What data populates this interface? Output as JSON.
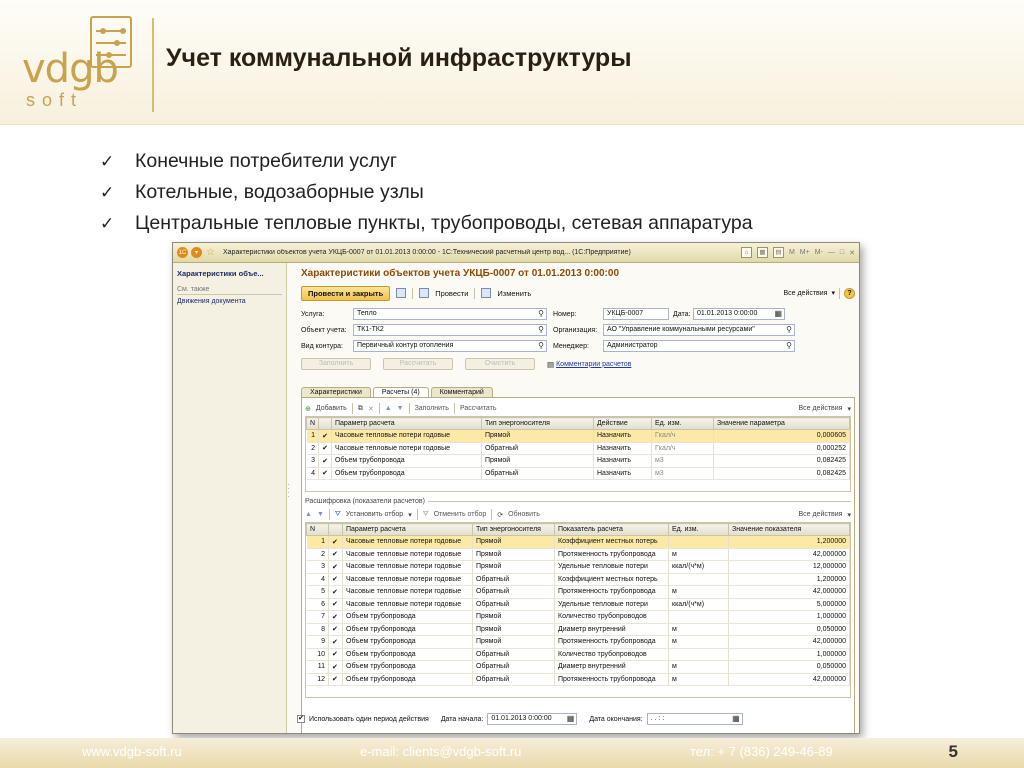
{
  "slide": {
    "logo": {
      "main": "vdgb",
      "sub": "soft"
    },
    "title": "Учет коммунальной инфраструктуры",
    "bullets": [
      "Конечные потребители услуг",
      "Котельные, водозаборные узлы",
      "Центральные тепловые пункты, трубопроводы,  сетевая аппаратура"
    ],
    "footer": {
      "website": "www.vdgb-soft.ru",
      "email": "e-mail: clients@vdgb-soft.ru",
      "phone": "тел: + 7 (836) 249-46-89",
      "page": "5"
    }
  },
  "window": {
    "title": "Характеристики объектов учета УКЦБ-0007 от 01.01.2013 0:00:00 - 1С:Технический расчетный центр вод... (1С:Предприятие)",
    "toolbar_labels": [
      "M",
      "M+",
      "M-"
    ],
    "side": {
      "title": "Характеристики объе...",
      "group": "См. также",
      "link": "Движения документа"
    },
    "form_title": "Характеристики объектов учета УКЦБ-0007 от 01.01.2013 0:00:00",
    "commands": {
      "post_close": "Провести и закрыть",
      "post": "Провести",
      "edit": "Изменить",
      "all_actions": "Все действия",
      "help": "?"
    },
    "fields": {
      "service_label": "Услуга:",
      "service_value": "Тепло",
      "object_label": "Объект учета:",
      "object_value": "ТК1-ТК2",
      "circuit_label": "Вид контура:",
      "circuit_value": "Первичный контур отопления",
      "number_label": "Номер:",
      "number_value": "УКЦБ-0007",
      "date_label": "Дата:",
      "date_value": "01.01.2013  0:00:00",
      "org_label": "Организация:",
      "org_value": "АО \"Управление коммунальными ресурсами\"",
      "manager_label": "Менеджер:",
      "manager_value": "Администратор",
      "fill_btn": "Заполнить",
      "calc_btn": "Рассчитать",
      "clear_btn": "Очистить",
      "comment_link": "Комментарии расчетов"
    },
    "tabs": [
      "Характеристики",
      "Расчеты (4)",
      "Комментарий"
    ],
    "grid1": {
      "toolbar": {
        "add": "Добавить",
        "fill": "Заполнить",
        "calc": "Рассчитать",
        "all_actions": "Все действия"
      },
      "headers": [
        "N",
        "",
        "Параметр расчета",
        "Тип энергоносителя",
        "Действие",
        "Ед. изм.",
        "Значение параметра"
      ],
      "rows": [
        [
          "1",
          "✔",
          "Часовые тепловые потери годовые",
          "Прямой",
          "Назначить",
          "Гкал/ч",
          "0,000605"
        ],
        [
          "2",
          "✔",
          "Часовые тепловые потери годовые",
          "Обратный",
          "Назначить",
          "Гкал/ч",
          "0,000252"
        ],
        [
          "3",
          "✔",
          "Объем трубопровода",
          "Прямой",
          "Назначить",
          "м3",
          "0,082425"
        ],
        [
          "4",
          "✔",
          "Объем трубопровода",
          "Обратный",
          "Назначить",
          "м3",
          "0,082425"
        ]
      ]
    },
    "section_caption": "Расшифровка (показатели расчетов)",
    "grid2": {
      "toolbar": {
        "set_filter": "Установить отбор",
        "clear_filter": "Отменить отбор",
        "refresh": "Обновить",
        "all_actions": "Все действия"
      },
      "headers": [
        "N",
        "",
        "Параметр расчета",
        "Тип энергоносителя",
        "Показатель расчета",
        "Ед. изм.",
        "Значение показателя"
      ],
      "rows": [
        [
          "1",
          "✔",
          "Часовые тепловые потери годовые",
          "Прямой",
          "Коэффициент местных потерь",
          "",
          "1,200000"
        ],
        [
          "2",
          "✔",
          "Часовые тепловые потери годовые",
          "Прямой",
          "Протяженность трубопровода",
          "м",
          "42,000000"
        ],
        [
          "3",
          "✔",
          "Часовые тепловые потери годовые",
          "Прямой",
          "Удельные тепловые потери",
          "ккал/(ч*м)",
          "12,000000"
        ],
        [
          "4",
          "✔",
          "Часовые тепловые потери годовые",
          "Обратный",
          "Коэффициент местных потерь",
          "",
          "1,200000"
        ],
        [
          "5",
          "✔",
          "Часовые тепловые потери годовые",
          "Обратный",
          "Протяженность трубопровода",
          "м",
          "42,000000"
        ],
        [
          "6",
          "✔",
          "Часовые тепловые потери годовые",
          "Обратный",
          "Удельные тепловые потери",
          "ккал/(ч*м)",
          "5,000000"
        ],
        [
          "7",
          "✔",
          "Объем трубопровода",
          "Прямой",
          "Количество трубопроводов",
          "",
          "1,000000"
        ],
        [
          "8",
          "✔",
          "Объем трубопровода",
          "Прямой",
          "Диаметр внутренний",
          "м",
          "0,050000"
        ],
        [
          "9",
          "✔",
          "Объем трубопровода",
          "Прямой",
          "Протяженность трубопровода",
          "м",
          "42,000000"
        ],
        [
          "10",
          "✔",
          "Объем трубопровода",
          "Обратный",
          "Количество трубопроводов",
          "",
          "1,000000"
        ],
        [
          "11",
          "✔",
          "Объем трубопровода",
          "Обратный",
          "Диаметр внутренний",
          "м",
          "0,050000"
        ],
        [
          "12",
          "✔",
          "Объем трубопровода",
          "Обратный",
          "Протяженность трубопровода",
          "м",
          "42,000000"
        ]
      ]
    },
    "bottom": {
      "single_period": "Использовать один период действия",
      "start_label": "Дата начала:",
      "start_value": "01.01.2013  0:00:00",
      "end_label": "Дата окончания:",
      "end_value": " .  .     :  :"
    }
  }
}
